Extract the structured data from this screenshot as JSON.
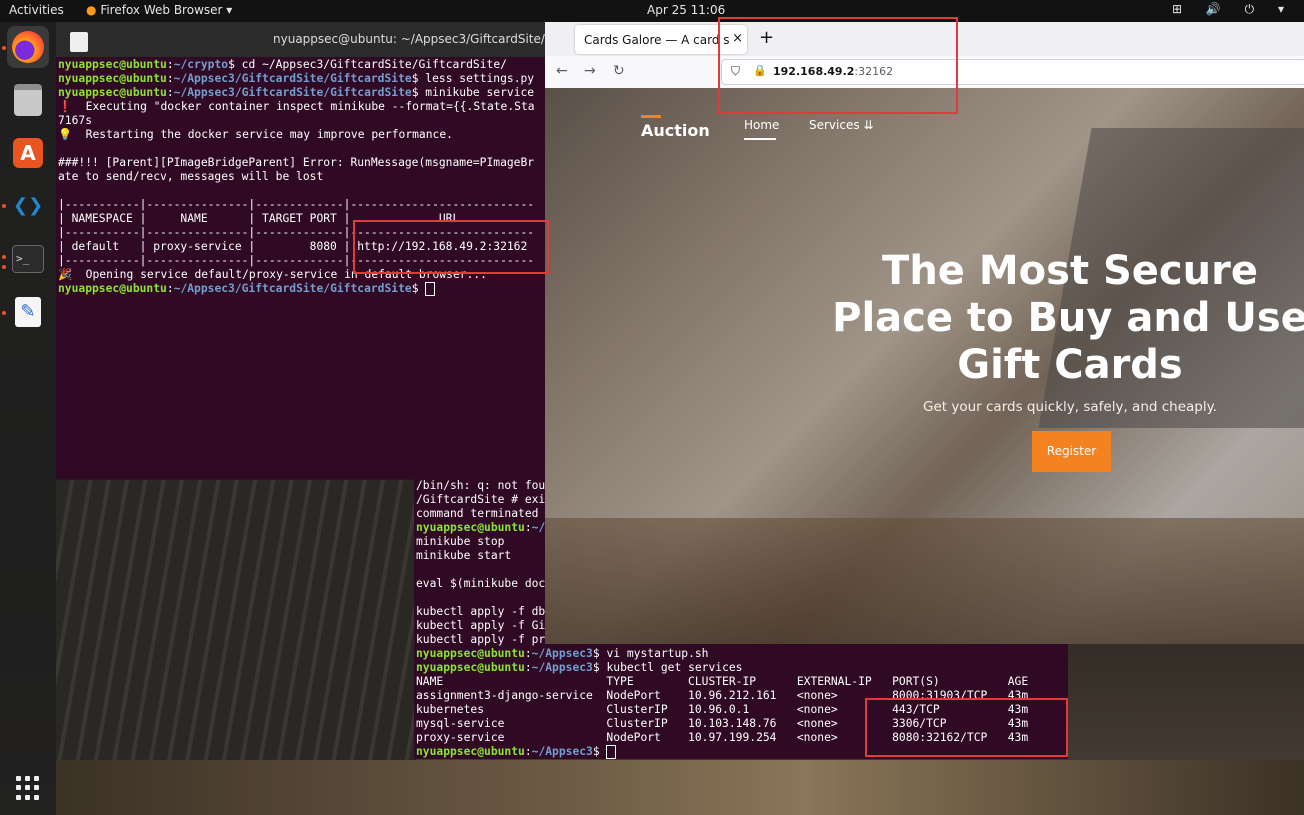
{
  "topbar": {
    "activities": "Activities",
    "app_name": "Firefox Web Browser",
    "app_arrow": "▾",
    "datetime": "Apr 25  11:06",
    "tray_icons": [
      "network-icon",
      "volume-icon",
      "power-icon",
      "menu-arrow-icon"
    ],
    "tray_text": "⊞ 🔊 ⏻ ▾"
  },
  "dock": {
    "items": [
      "firefox",
      "files",
      "app-center",
      "vscode",
      "terminal",
      "text-editor",
      "show-applications"
    ],
    "store_glyph": "A",
    "vscode_glyph": "❮❯",
    "term_glyph": ">_",
    "edit_glyph": "✎"
  },
  "terminal1": {
    "title": "nyuappsec@ubuntu: ~/Appsec3/GiftcardSite/",
    "lines": [
      {
        "user": "nyuappsec@ubuntu",
        "path": "~/crypto",
        "cmd": "$ cd ~/Appsec3/GiftcardSite/GiftcardSite/"
      },
      {
        "user": "nyuappsec@ubuntu",
        "path": "~/Appsec3/GiftcardSite/GiftcardSite",
        "cmd": "$ less settings.py"
      },
      {
        "user": "nyuappsec@ubuntu",
        "path": "~/Appsec3/GiftcardSite/GiftcardSite",
        "cmd": "$ minikube service"
      },
      {
        "text": "❗  Executing \"docker container inspect minikube --format={{.State.Sta"
      },
      {
        "text": "7167s"
      },
      {
        "text": "💡  Restarting the docker service may improve performance."
      },
      {
        "text": ""
      },
      {
        "text": "###!!! [Parent][PImageBridgeParent] Error: RunMessage(msgname=PImageBr"
      },
      {
        "text": "ate to send/recv, messages will be lost"
      },
      {
        "text": ""
      },
      {
        "text": "|-----------|---------------|-------------|---------------------------"
      },
      {
        "text": "| NAMESPACE |     NAME      | TARGET PORT |             URL"
      },
      {
        "text": "|-----------|---------------|-------------|---------------------------"
      },
      {
        "text": "| default   | proxy-service |        8080 | http://192.168.49.2:32162"
      },
      {
        "text": "|-----------|---------------|-------------|---------------------------"
      },
      {
        "text": "🎉  Opening service default/proxy-service in default browser..."
      },
      {
        "user": "nyuappsec@ubuntu",
        "path": "~/Appsec3/GiftcardSite/GiftcardSite",
        "cmd": "$ "
      }
    ]
  },
  "terminal2": {
    "lines": [
      {
        "text": "/bin/sh: q: not fou"
      },
      {
        "text": "/GiftcardSite # exi"
      },
      {
        "text": "command terminated"
      },
      {
        "user": "nyuappsec@ubuntu",
        "path": "~/",
        "cmd": ""
      },
      {
        "text": "minikube stop"
      },
      {
        "text": "minikube start"
      },
      {
        "text": ""
      },
      {
        "text": "eval $(minikube doc"
      },
      {
        "text": ""
      },
      {
        "text": "kubectl apply -f db"
      },
      {
        "text": "kubectl apply -f Gi"
      },
      {
        "text": "kubectl apply -f pr"
      },
      {
        "user": "nyuappsec@ubuntu",
        "path": "~/Appsec3",
        "cmd": "$ vi mystartup.sh"
      },
      {
        "user": "nyuappsec@ubuntu",
        "path": "~/Appsec3",
        "cmd": "$ kubectl get services"
      },
      {
        "text": "NAME                        TYPE        CLUSTER-IP      EXTERNAL-IP   PORT(S)          AGE"
      },
      {
        "text": "assignment3-django-service  NodePort    10.96.212.161   <none>        8000:31903/TCP   43m"
      },
      {
        "text": "kubernetes                  ClusterIP   10.96.0.1       <none>        443/TCP          43m"
      },
      {
        "text": "mysql-service               ClusterIP   10.103.148.76   <none>        3306/TCP         43m"
      },
      {
        "text": "proxy-service               NodePort    10.97.199.254   <none>        8080:32162/TCP   43m"
      },
      {
        "user": "nyuappsec@ubuntu",
        "path": "~/Appsec3",
        "cmd": "$ "
      }
    ]
  },
  "browser": {
    "tab_title": "Cards Galore — A card sales",
    "tab_close": "×",
    "new_tab": "+",
    "back": "←",
    "forward": "→",
    "reload": "↻",
    "shield": "⛉",
    "lock": "🔒",
    "url_host": "192.168.49.2",
    "url_port": ":32162",
    "site": {
      "logo": "Auction",
      "nav_home": "Home",
      "nav_services": "Services ⇊",
      "hero_title": "The Most Secure Place to Buy and Use Gift Cards",
      "hero_subtitle": "Get your cards quickly, safely, and cheaply.",
      "register_button": "Register"
    }
  },
  "colors": {
    "terminal_bg": "#300a24",
    "prompt_user": "#8ae234",
    "prompt_path": "#729fcf",
    "accent_orange": "#f58220",
    "annotation_red": "#e03a3a"
  }
}
